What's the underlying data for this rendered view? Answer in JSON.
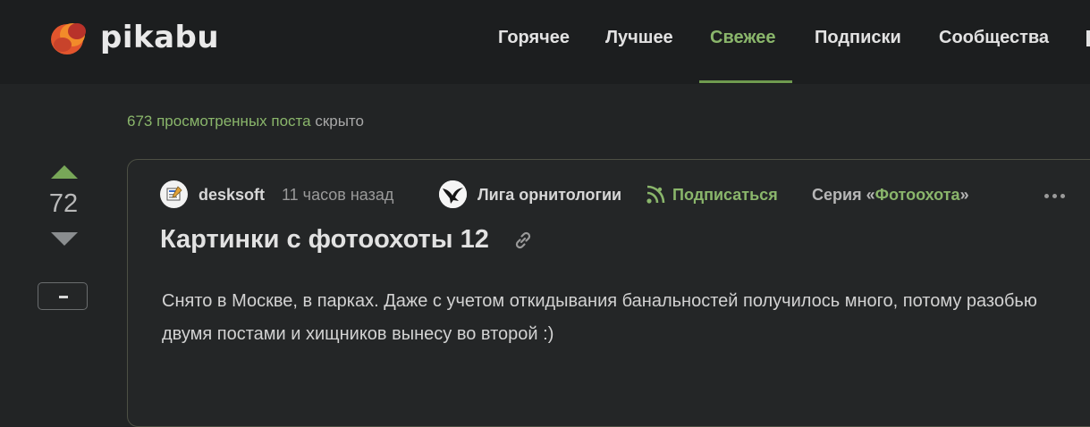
{
  "header": {
    "brand": "pikabu",
    "nav": [
      {
        "label": "Горячее",
        "active": false
      },
      {
        "label": "Лучшее",
        "active": false
      },
      {
        "label": "Свежее",
        "active": true
      },
      {
        "label": "Подписки",
        "active": false
      },
      {
        "label": "Сообщества",
        "active": false
      }
    ],
    "accent": "#8ab66b"
  },
  "viewed": {
    "count_text": "673 просмотренных поста",
    "suffix": " скрыто"
  },
  "vote": {
    "count": "72",
    "minus_label": "-"
  },
  "post": {
    "author": "desksoft",
    "time": "11 часов назад",
    "community": "Лига орнитологии",
    "subscribe": "Подписаться",
    "series_prefix": "Серия «",
    "series_name": "Фотоохота",
    "series_suffix": "»",
    "title": "Картинки с фотоохоты 12",
    "body": "Снято в Москве, в парках. Даже с учетом откидывания банальностей получилось много, потому разобью двумя постами и хищников вынесу во второй :)"
  },
  "icons": {
    "logo": "pikabu-logo-icon",
    "subscribe": "rss-icon",
    "link": "link-icon",
    "more": "more-dots-icon"
  }
}
